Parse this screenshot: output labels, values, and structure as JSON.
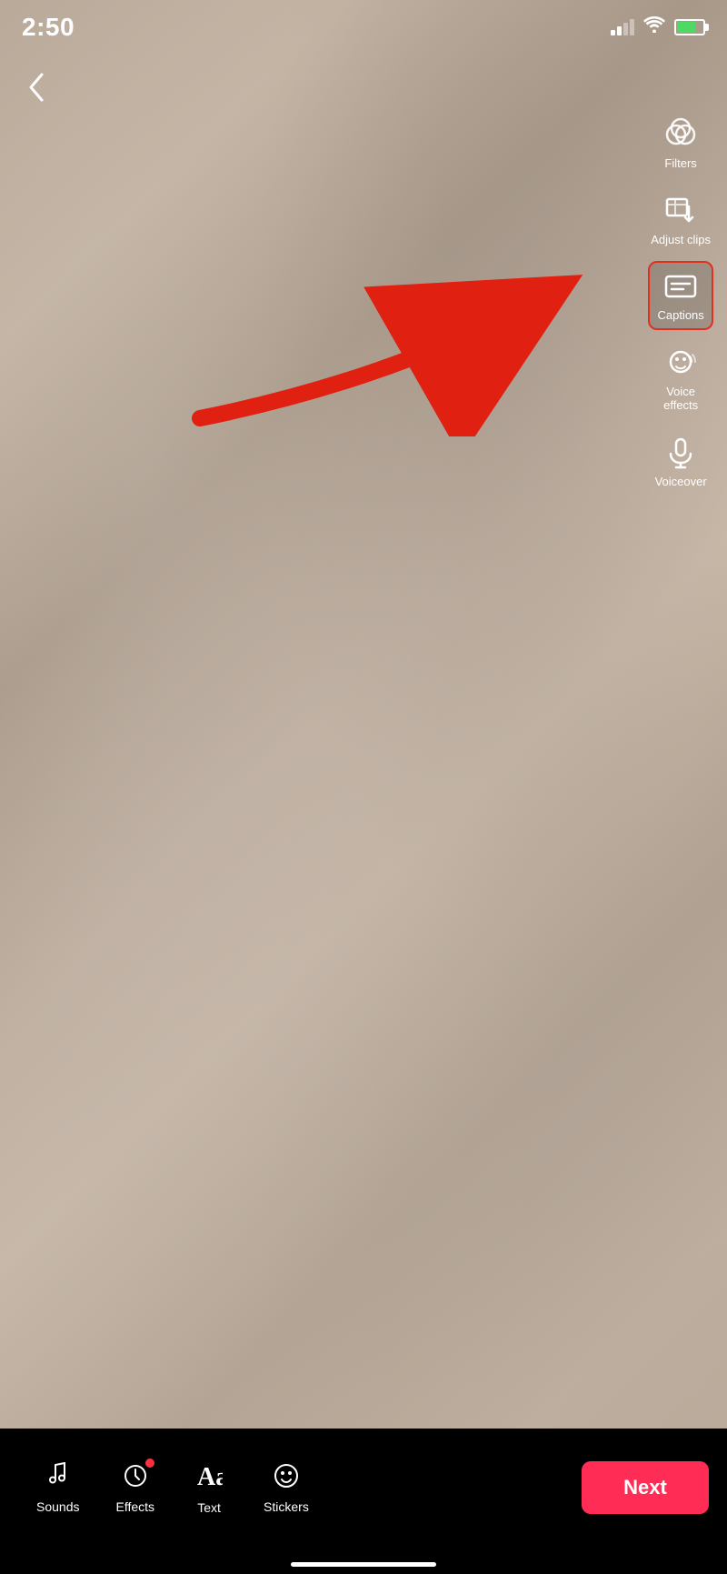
{
  "statusBar": {
    "time": "2:50"
  },
  "toolbar": {
    "back_label": "‹",
    "filters_label": "Filters",
    "adjust_label": "Adjust clips",
    "captions_label": "Captions",
    "voice_effects_label": "Voice\neffects",
    "voiceover_label": "Voiceover"
  },
  "bottomNav": {
    "sounds_label": "Sounds",
    "effects_label": "Effects",
    "text_label": "Text",
    "stickers_label": "Stickers",
    "next_label": "Next"
  },
  "colors": {
    "accent": "#ff2d55",
    "highlight_border": "#e03020",
    "battery_green": "#4CD964"
  }
}
